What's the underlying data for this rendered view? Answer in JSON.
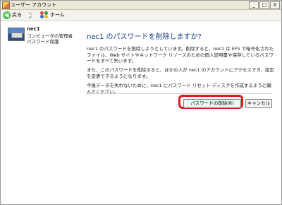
{
  "window": {
    "title": "ユーザー アカウント",
    "controls": {
      "minimize": "_",
      "maximize": "□",
      "close": "X"
    }
  },
  "nav": {
    "back_label": "戻る",
    "home_label": "ホーム"
  },
  "user": {
    "name": "nec1",
    "type": "コンピュータの管理者",
    "password_state": "パスワード保護"
  },
  "main": {
    "heading": "nec1 のパスワードを削除しますか?",
    "paragraphs": [
      "nec1 のパスワードを削除しようとしています。削除すると、nec1 は EFS で暗号化されたファイル、Web サイトやネットワーク リソースのための個人証明書や保存しているパスワードをすべて失います。",
      "また、このパスワードを削除すると、ほかの人が nec1 のアカウントにアクセスでき、設定を変更できるようになります。",
      "今後データを失わないために、nec1 にパスワード リセット ディスクを作成するように頼んでください。"
    ]
  },
  "buttons": {
    "remove": "パスワードの削除(R)",
    "cancel": "キャンセル"
  },
  "colors": {
    "heading": "#1b3f8e",
    "highlight": "#e01818"
  }
}
